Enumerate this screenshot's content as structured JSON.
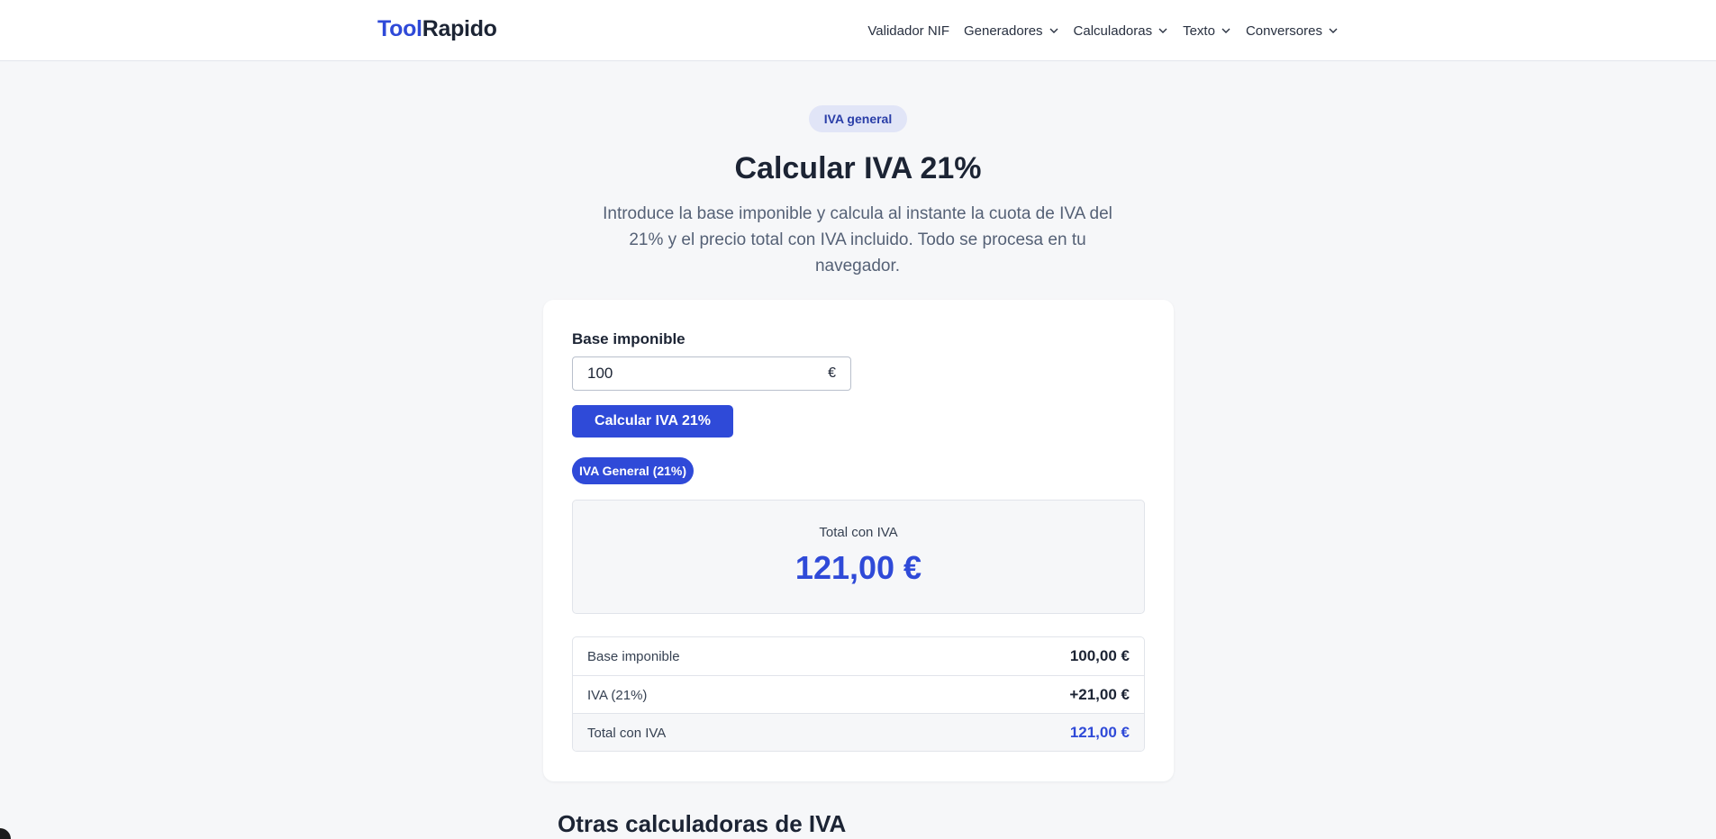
{
  "header": {
    "logo_part1": "Tool",
    "logo_part2": "Rapido",
    "nav": [
      {
        "label": "Validador NIF",
        "has_dropdown": false
      },
      {
        "label": "Generadores",
        "has_dropdown": true
      },
      {
        "label": "Calculadoras",
        "has_dropdown": true
      },
      {
        "label": "Texto",
        "has_dropdown": true
      },
      {
        "label": "Conversores",
        "has_dropdown": true
      }
    ]
  },
  "hero": {
    "badge": "IVA general",
    "title": "Calcular IVA 21%",
    "description": "Introduce la base imponible y calcula al instante la cuota de IVA del 21% y el precio total con IVA incluido. Todo se procesa en tu navegador."
  },
  "calculator": {
    "input_label": "Base imponible",
    "input_value": "100",
    "currency_symbol": "€",
    "button_label": "Calcular IVA 21%",
    "rate_chip": "IVA General (21%)",
    "result_label": "Total con IVA",
    "result_value": "121,00 €",
    "breakdown": [
      {
        "label": "Base imponible",
        "value": "100,00 €"
      },
      {
        "label": "IVA (21%)",
        "value": "+21,00 €"
      },
      {
        "label": "Total con IVA",
        "value": "121,00 €"
      }
    ]
  },
  "section": {
    "title": "Otras calculadoras de IVA"
  },
  "colors": {
    "accent": "#2f4ad8",
    "text": "#1c2434",
    "muted": "#556176",
    "background": "#f6f7f9"
  }
}
